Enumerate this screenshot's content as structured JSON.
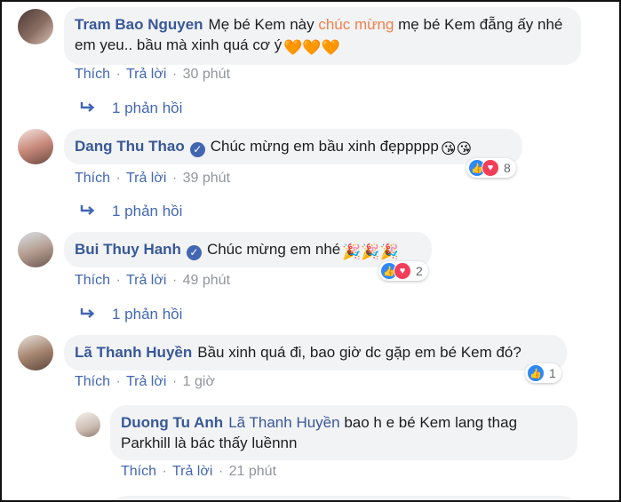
{
  "comments": [
    {
      "author": "Tram Bao Nguyen",
      "text_before": "Mẹ bé Kem này ",
      "text_highlight": "chúc mừng",
      "text_after": " mẹ bé Kem đẵng ấy nhé em yeu.. bầu mà xinh quá cơ ý",
      "hearts": "🧡🧡🧡",
      "like": "Thích",
      "reply": "Trả lời",
      "time": "30 phút",
      "replies": "1 phản hồi"
    },
    {
      "author": "Dang Thu Thao",
      "text": "Chúc mừng em bầu xinh đẹppppp",
      "emojis": "😘😘",
      "like": "Thích",
      "reply": "Trả lời",
      "time": "39 phút",
      "reaction_count": "8",
      "replies": "1 phản hồi"
    },
    {
      "author": "Bui Thuy Hanh",
      "text": "Chúc mừng em nhé",
      "emojis": "🎉🎉🎉",
      "like": "Thích",
      "reply": "Trả lời",
      "time": "49 phút",
      "reaction_count": "2",
      "replies": "1 phản hồi"
    },
    {
      "author": "Lã Thanh Huyền",
      "text": "Bầu xinh quá đi, bao giờ dc gặp em bé Kem đó?",
      "like": "Thích",
      "reply": "Trả lời",
      "time": "1 giờ",
      "reaction_count": "1"
    }
  ],
  "reply_comment": {
    "author": "Duong Tu Anh",
    "mention": "Lã Thanh Huyền",
    "text": " bao h e bé Kem lang thag Parkhill là bác thấy luềnnn",
    "like": "Thích",
    "reply": "Trả lời",
    "time": "21 phút"
  },
  "separator": "·",
  "colors": {
    "link": "#385898",
    "bubble": "#f2f3f5",
    "meta": "#90949c",
    "highlight": "#f0814a"
  }
}
